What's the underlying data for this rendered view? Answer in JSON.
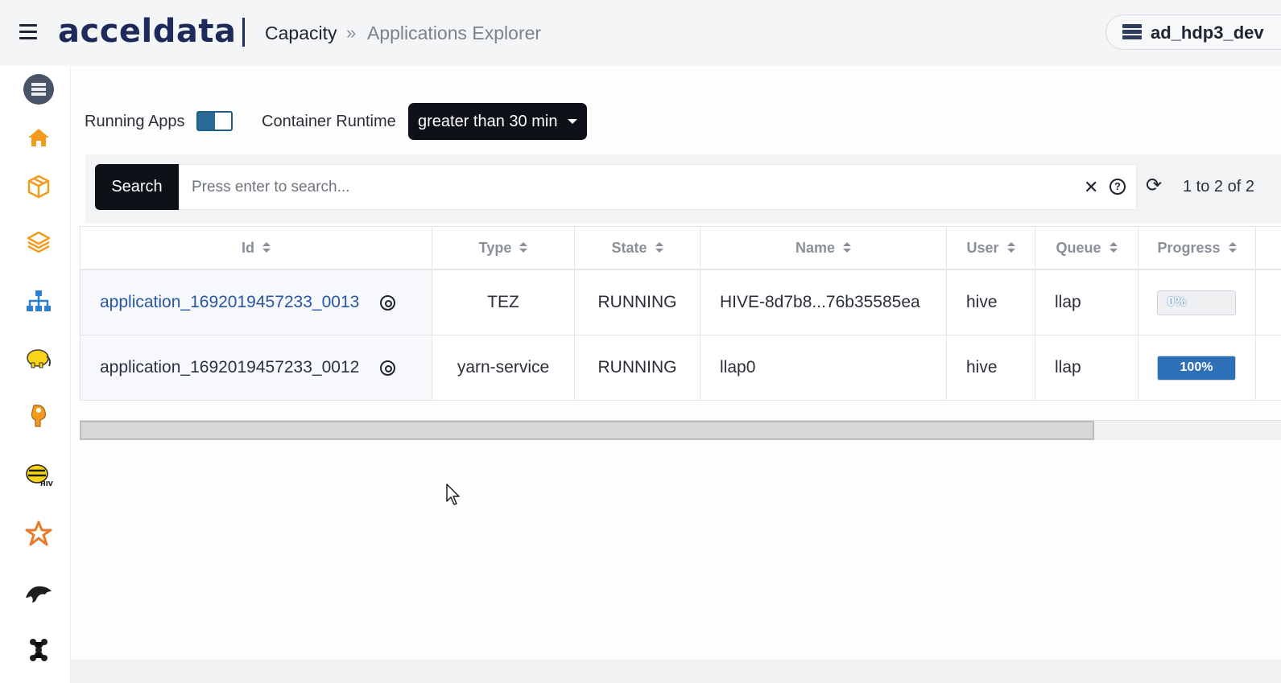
{
  "header": {
    "logo_text": "acceldata",
    "breadcrumb": {
      "section": "Capacity",
      "separator": "»",
      "page": "Applications Explorer"
    },
    "cluster_name": "ad_hdp3_dev"
  },
  "sidebar": {
    "items": [
      {
        "icon": "cluster-server-icon"
      },
      {
        "icon": "home-icon"
      },
      {
        "icon": "package-icon"
      },
      {
        "icon": "layers-icon"
      },
      {
        "icon": "hierarchy-icon"
      },
      {
        "icon": "hadoop-elephant-icon"
      },
      {
        "icon": "hdfs-elephant-icon"
      },
      {
        "icon": "hive-bee-icon"
      },
      {
        "icon": "spark-star-icon"
      },
      {
        "icon": "mysql-dolphin-icon"
      },
      {
        "icon": "kafka-nodes-icon"
      }
    ]
  },
  "filters": {
    "running_apps_label": "Running Apps",
    "running_apps_on": true,
    "container_runtime_label": "Container Runtime",
    "container_runtime_value": "greater than 30 min"
  },
  "search": {
    "button_label": "Search",
    "placeholder": "Press enter to search...",
    "clear_symbol": "✕",
    "help_symbol": "?",
    "refresh_symbol": "⟳",
    "pagination": "1 to 2 of 2"
  },
  "table": {
    "columns": [
      "Id",
      "Type",
      "State",
      "Name",
      "User",
      "Queue",
      "Progress"
    ],
    "rows": [
      {
        "id": "application_1692019457233_0013",
        "type": "TEZ",
        "state": "RUNNING",
        "name": "HIVE-8d7b8...76b35585ea",
        "user": "hive",
        "queue": "llap",
        "progress_label": "0%",
        "progress": 0
      },
      {
        "id": "application_1692019457233_0012",
        "type": "yarn-service",
        "state": "RUNNING",
        "name": "llap0",
        "user": "hive",
        "queue": "llap",
        "progress_label": "100%",
        "progress": 100
      }
    ]
  },
  "colors": {
    "brand": "#1e2a5a",
    "toggle": "#2a6a94",
    "progress": "#2e70b8",
    "link": "#2856a3",
    "icon_orange": "#f29c1f"
  }
}
